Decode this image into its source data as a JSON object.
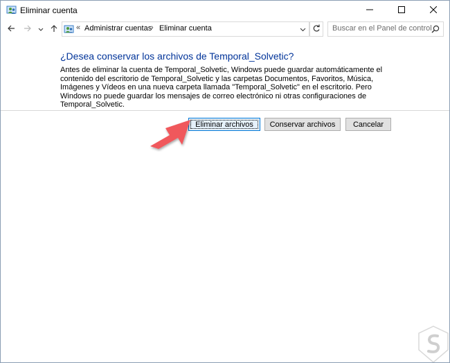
{
  "window": {
    "title": "Eliminar cuenta"
  },
  "address": {
    "lead_separator": "«",
    "crumbs": [
      "Administrar cuentas",
      "Eliminar cuenta"
    ],
    "separator": "›"
  },
  "search": {
    "placeholder": "Buscar en el Panel de control"
  },
  "content": {
    "heading": "¿Desea conservar los archivos de Temporal_Solvetic?",
    "description": "Antes de eliminar la cuenta de Temporal_Solvetic, Windows puede guardar automáticamente el contenido del escritorio de Temporal_Solvetic y las carpetas Documentos, Favoritos, Música, Imágenes y Vídeos en una nueva carpeta llamada \"Temporal_Solvetic\" en el escritorio. Pero Windows no puede guardar los mensajes de correo electrónico ni otras configuraciones de Temporal_Solvetic."
  },
  "buttons": {
    "delete_files": "Eliminar archivos",
    "keep_files": "Conservar archivos",
    "cancel": "Cancelar"
  },
  "icons": {
    "app": "user-accounts-icon",
    "minimize": "minimize-icon",
    "maximize": "maximize-icon",
    "close": "close-icon",
    "back": "back-arrow-icon",
    "forward": "forward-arrow-icon",
    "recent": "chevron-down-icon",
    "up": "up-arrow-icon",
    "refresh": "refresh-icon",
    "search": "search-icon",
    "annotation": "red-arrow-icon",
    "watermark": "solvetic-logo-icon"
  },
  "colors": {
    "heading": "#003399",
    "arrow": "#f0585c",
    "focus_border": "#0078d7"
  }
}
